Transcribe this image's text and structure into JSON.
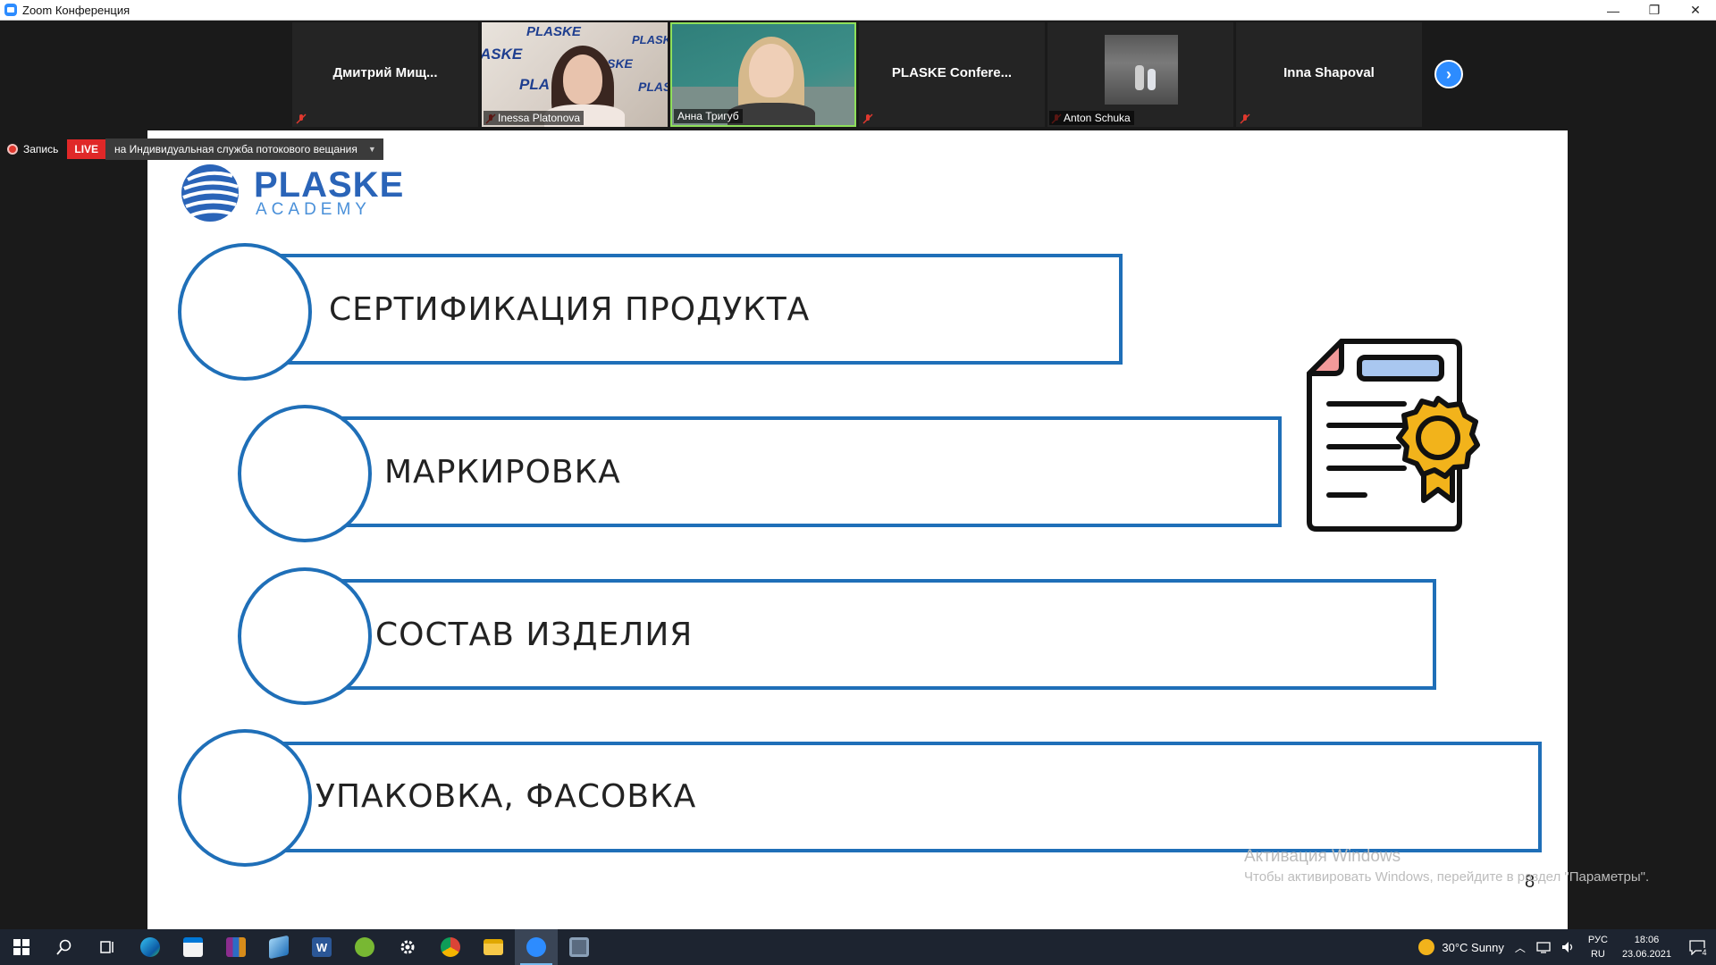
{
  "window": {
    "title": "Zoom Конференция",
    "controls": {
      "minimize": "—",
      "restore": "❐",
      "close": "✕"
    }
  },
  "participants": [
    {
      "name": "Дмитрий  Мищ...",
      "has_video": false,
      "muted": true
    },
    {
      "name": "Inessa Platonova",
      "has_video": true,
      "muted": true,
      "backdrop_text": [
        "PLASKE",
        "ASKE",
        "PLASK",
        "ASKE",
        "PLAS",
        "PLA"
      ]
    },
    {
      "name": "Анна Тригуб",
      "has_video": true,
      "muted": false,
      "active_speaker": true
    },
    {
      "name": "PLASKE  Confere...",
      "has_video": false,
      "muted": true
    },
    {
      "name": "Anton Schuka",
      "has_video": false,
      "muted": true,
      "has_avatar": true
    },
    {
      "name": "Inna Shapoval",
      "has_video": false,
      "muted": true
    }
  ],
  "next_page_icon": "chevron-right-icon",
  "recording": {
    "label": "Запись",
    "live_badge": "LIVE",
    "stream_target": "на Индивидуальная служба потокового вещания"
  },
  "slide": {
    "logo": {
      "line1": "PLASKE",
      "line2": "ACADEMY"
    },
    "items": [
      "СЕРТИФИКАЦИЯ ПРОДУКТА",
      "МАРКИРОВКА",
      "СОСТАВ ИЗДЕЛИЯ",
      "УПАКОВКА, ФАСОВКА"
    ],
    "page_number": "8",
    "illustration": "certificate-icon"
  },
  "watermark": {
    "line1": "Активация Windows",
    "line2": "Чтобы активировать Windows, перейдите в раздел \"Параметры\"."
  },
  "taskbar": {
    "apps": [
      "windows-start-icon",
      "search-icon",
      "task-view-icon",
      "edge-icon",
      "store-icon",
      "winrar-icon",
      "remote-desktop-icon",
      "word-icon",
      "utorrent-icon",
      "settings-icon",
      "chrome-icon",
      "file-explorer-icon",
      "zoom-icon",
      "calculator-icon"
    ],
    "weather": "30°C  Sunny",
    "lang_top": "РУС",
    "lang_bottom": "RU",
    "time": "18:06",
    "date": "23.06.2021",
    "notification_count": "4"
  },
  "colors": {
    "accent_blue": "#1f6fb8",
    "zoom_blue": "#2d8cff",
    "live_red": "#e02828",
    "active_speaker_border": "#8ee05a",
    "logo_blue": "#2a64b8"
  }
}
